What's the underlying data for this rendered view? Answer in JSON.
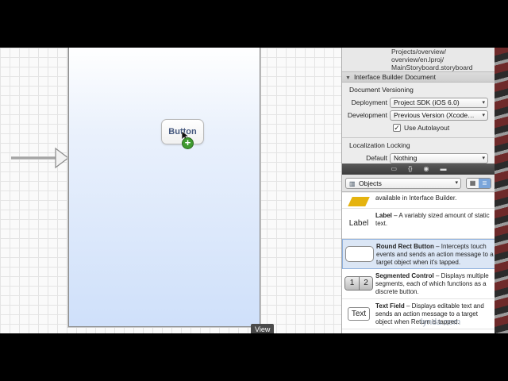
{
  "canvas": {
    "drag_button_label": "Button",
    "view_tag": "View"
  },
  "inspector": {
    "file_path": [
      "Projects/overview/",
      "overview/en.lproj/",
      "MainStoryboard.storyboard"
    ],
    "ib_document_header": "Interface Builder Document",
    "document_versioning": {
      "title": "Document Versioning",
      "deployment_label": "Deployment",
      "deployment_value": "Project SDK (iOS 6.0)",
      "development_label": "Development",
      "development_value": "Previous Version (Xcode…"
    },
    "use_autolayout": {
      "label": "Use Autolayout",
      "checked": true,
      "check_glyph": "✓"
    },
    "localization": {
      "title": "Localization Locking",
      "default_label": "Default",
      "default_value": "Nothing"
    },
    "library_select": "Objects",
    "library_items": [
      {
        "thumb": "",
        "title": "",
        "text": "available in Interface Builder."
      },
      {
        "thumb": "Label",
        "title": "Label",
        "text": " – A variably sized amount of static text."
      },
      {
        "thumb": "",
        "title": "Round Rect Button",
        "text": " – Intercepts touch events and sends an action message to a target object when it's tapped."
      },
      {
        "thumb_segments": [
          "1",
          "2"
        ],
        "title": "Segmented Control",
        "text": " – Displays multiple segments, each of which functions as a discrete button."
      },
      {
        "thumb": "Text",
        "title": "Text Field",
        "text": " – Displays editable text and sends an action message to a target object when Return is tapped."
      }
    ]
  },
  "watermark": "lynda.com",
  "colors": {
    "accent_green": "#3f9a2f",
    "selected_row": "#dbe6f5",
    "list_toggle": "#7aa5da"
  }
}
